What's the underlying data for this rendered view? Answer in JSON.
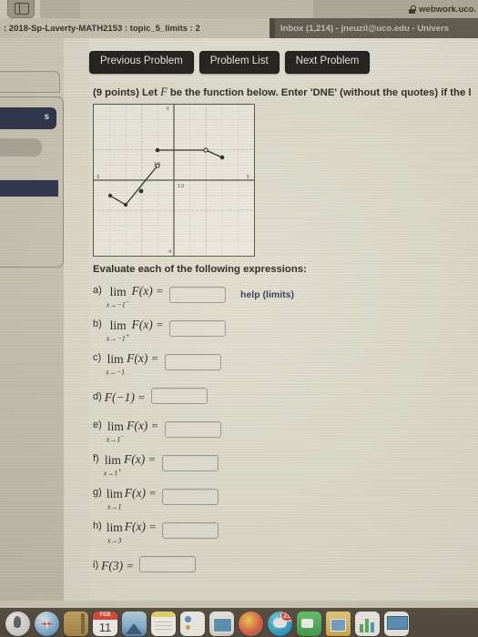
{
  "browser": {
    "sidebar_toggle_icon": "sidebar-toggle-icon",
    "lock_icon": "lock-icon",
    "url": "webwork.uco.",
    "tabs": [
      {
        "label": ": 2018-Sp-Laverty-MATH2153 : topic_5_limits : 2",
        "active": true
      },
      {
        "label": "Inbox (1,214) - jneuzil@uco.edu - Univers",
        "active": false
      }
    ]
  },
  "toolbar": {
    "previous_problem": "Previous Problem",
    "problem_list": "Problem List",
    "next_problem": "Next Problem"
  },
  "problem": {
    "intro_prefix": "(9 points) Let ",
    "intro_symbol": "F",
    "intro_suffix": " be the function below. Enter 'DNE' (without the quotes) if the l",
    "evaluate_line": "Evaluate each of the following expressions:",
    "help_link": "help (limits)"
  },
  "expressions": [
    {
      "letter": "a)",
      "kind": "limit",
      "lim": "lim",
      "sub": "x→−1",
      "supscript": "−",
      "body": "F(x)",
      "equals": "=",
      "value": "",
      "help": true
    },
    {
      "letter": "b)",
      "kind": "limit",
      "lim": "lim",
      "sub": "x→−1",
      "supscript": "+",
      "body": "F(x)",
      "equals": "=",
      "value": "",
      "help": false
    },
    {
      "letter": "c)",
      "kind": "limit",
      "lim": "lim",
      "sub": "x→−1",
      "supscript": "",
      "body": "F(x)",
      "equals": "=",
      "value": "",
      "help": false
    },
    {
      "letter": "d)",
      "kind": "value",
      "lim": "",
      "sub": "",
      "supscript": "",
      "body": "F(−1)",
      "equals": "=",
      "value": "",
      "help": false
    },
    {
      "letter": "e)",
      "kind": "limit",
      "lim": "lim",
      "sub": "x→1",
      "supscript": "−",
      "body": "F(x)",
      "equals": "=",
      "value": "",
      "help": false
    },
    {
      "letter": "f)",
      "kind": "limit",
      "lim": "lim",
      "sub": "x→1",
      "supscript": "+",
      "body": "F(x)",
      "equals": "=",
      "value": "",
      "help": false
    },
    {
      "letter": "g)",
      "kind": "limit",
      "lim": "lim",
      "sub": "x→1",
      "supscript": "",
      "body": "F(x)",
      "equals": "=",
      "value": "",
      "help": false
    },
    {
      "letter": "h)",
      "kind": "limit",
      "lim": "lim",
      "sub": "x→3",
      "supscript": "",
      "body": "F(x)",
      "equals": "=",
      "value": "",
      "help": false
    },
    {
      "letter": "i)",
      "kind": "value",
      "lim": "",
      "sub": "",
      "supscript": "",
      "body": "F(3)",
      "equals": "=",
      "value": "",
      "help": false
    }
  ],
  "chart_data": {
    "type": "line",
    "title": "",
    "xlabel": "",
    "ylabel": "",
    "xlim": [
      -5,
      5
    ],
    "ylim": [
      -4,
      6
    ],
    "grid": true,
    "legend": false,
    "axis_labels": [
      "-5",
      "1.0",
      "1.0",
      "5",
      "-4"
    ],
    "segments": [
      {
        "name": "left-branch-descending",
        "points": [
          [
            -4,
            -1
          ],
          [
            -3,
            -1.6
          ]
        ]
      },
      {
        "name": "rising-branch",
        "points": [
          [
            -3,
            -1.6
          ],
          [
            -1,
            1
          ]
        ]
      },
      {
        "name": "plateau",
        "points": [
          [
            -1,
            2
          ],
          [
            3,
            2
          ]
        ]
      },
      {
        "name": "right-descending",
        "points": [
          [
            3,
            2
          ],
          [
            4,
            1.4
          ]
        ]
      }
    ],
    "points": [
      {
        "x": -4,
        "y": -1,
        "fill": "closed"
      },
      {
        "x": -3,
        "y": -1.6,
        "fill": "closed"
      },
      {
        "x": -2,
        "y": -0.8,
        "fill": "closed"
      },
      {
        "x": -1,
        "y": 1,
        "fill": "open"
      },
      {
        "x": -1,
        "y": 2,
        "fill": "closed"
      },
      {
        "x": 3,
        "y": 2,
        "fill": "open"
      },
      {
        "x": 4,
        "y": 1.4,
        "fill": "closed"
      }
    ]
  },
  "dock": {
    "items": [
      {
        "name": "launchpad",
        "badge": ""
      },
      {
        "name": "safari",
        "badge": ""
      },
      {
        "name": "contacts-book",
        "badge": ""
      },
      {
        "name": "calendar",
        "badge": "",
        "month": "FEB",
        "day": "11"
      },
      {
        "name": "photos",
        "badge": ""
      },
      {
        "name": "notes",
        "badge": ""
      },
      {
        "name": "contacts",
        "badge": ""
      },
      {
        "name": "preview",
        "badge": ""
      },
      {
        "name": "photoshop",
        "badge": ""
      },
      {
        "name": "messages",
        "badge": "20"
      },
      {
        "name": "facetime",
        "badge": ""
      },
      {
        "name": "folder",
        "badge": ""
      },
      {
        "name": "numbers",
        "badge": ""
      },
      {
        "name": "keynote",
        "badge": ""
      }
    ]
  }
}
